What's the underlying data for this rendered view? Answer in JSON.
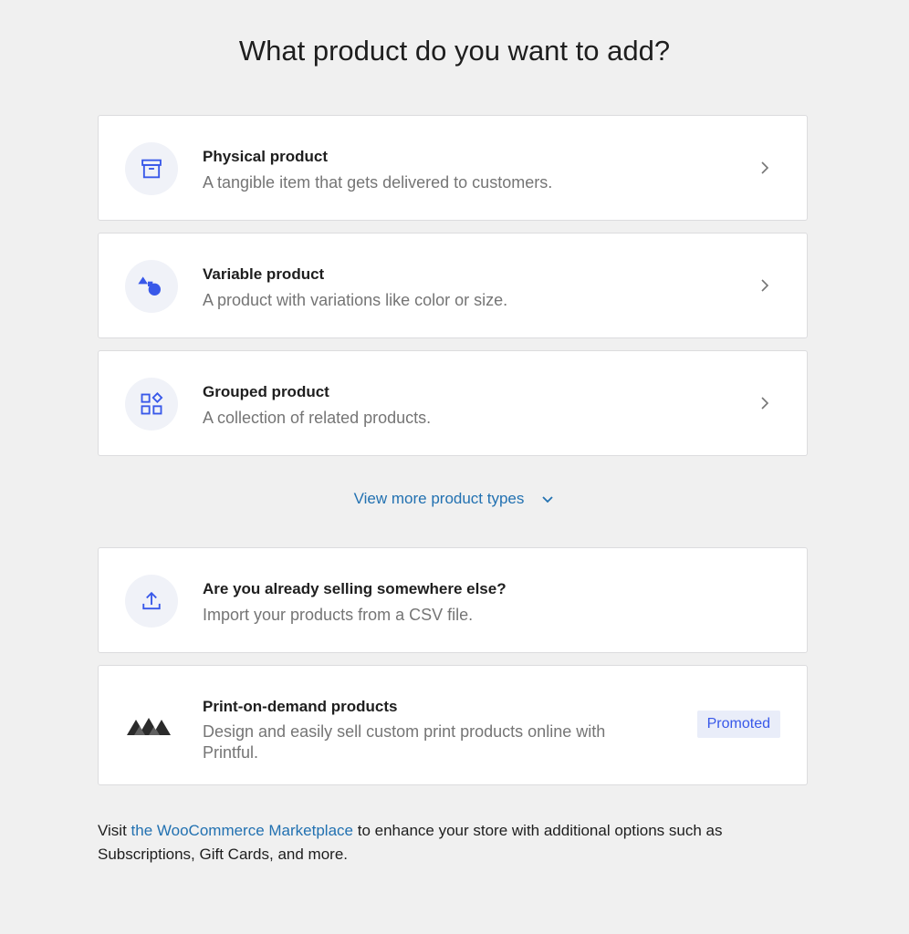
{
  "heading": "What product do you want to add?",
  "products": [
    {
      "title": "Physical product",
      "description": "A tangible item that gets delivered to customers.",
      "icon": "archive-box-icon"
    },
    {
      "title": "Variable product",
      "description": "A product with variations like color or size.",
      "icon": "shapes-icon"
    },
    {
      "title": "Grouped product",
      "description": "A collection of related products.",
      "icon": "grid-shapes-icon"
    }
  ],
  "view_more": "View more product types",
  "import": {
    "title": "Are you already selling somewhere else?",
    "description": "Import your products from a CSV file.",
    "icon": "upload-icon"
  },
  "printful": {
    "title": "Print-on-demand products",
    "description": "Design and easily sell custom print products online with Printful.",
    "badge": "Promoted",
    "icon": "printful-logo-icon"
  },
  "footer": {
    "prefix": "Visit ",
    "link": "the WooCommerce Marketplace",
    "suffix": " to enhance your store with additional options such as Subscriptions, Gift Cards, and more."
  },
  "colors": {
    "accent": "#3858e9",
    "link": "#2271b1",
    "background": "#f0f0f0"
  }
}
